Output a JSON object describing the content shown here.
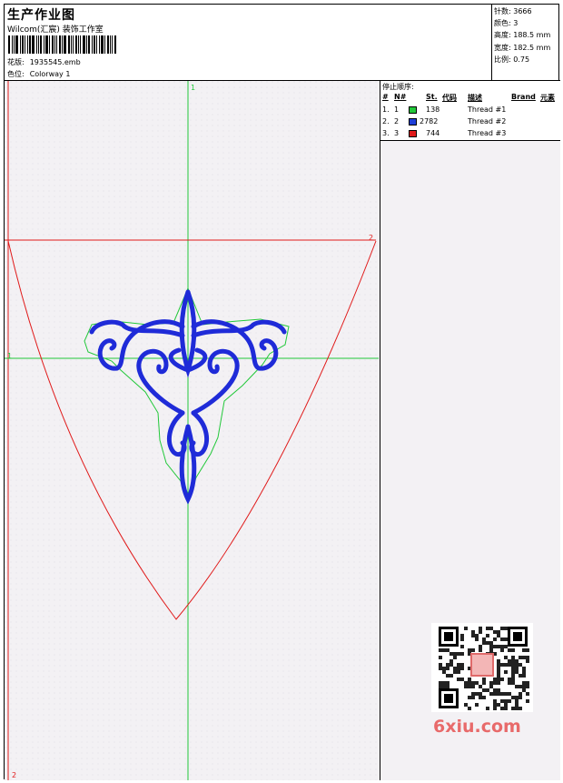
{
  "header": {
    "title": "生产作业图",
    "studio": "Wilcom(汇宸) 装饰工作室",
    "design_label": "花版:",
    "design_value": "1935545.emb",
    "colorway_label": "色位:",
    "colorway_value": "Colorway 1"
  },
  "specs": {
    "stitches": "针数: 3666",
    "colors": "颜色: 3",
    "height": "高度: 188.5 mm",
    "width": "宽度: 182.5 mm",
    "scale": "比例: 0.75"
  },
  "stop_sequence": {
    "title": "停止顺序:",
    "columns": {
      "hash": "#",
      "n": "N#",
      "st": "St.",
      "code": "代码",
      "desc": "描述",
      "brand": "Brand",
      "element": "元素"
    },
    "rows": [
      {
        "num": "1.",
        "n": "1",
        "color": "#22c83a",
        "st": "138",
        "desc": "Thread #1"
      },
      {
        "num": "2.",
        "n": "2",
        "color": "#1f3fd8",
        "st": "2782",
        "desc": "Thread #2"
      },
      {
        "num": "3.",
        "n": "3",
        "color": "#e01a1a",
        "st": "744",
        "desc": "Thread #3"
      }
    ]
  },
  "guides": {
    "top_marker": "1",
    "left_marker": "1",
    "right_marker": "2",
    "bottom_marker": "2"
  },
  "watermark": "6xiu.com",
  "colors": {
    "guide_green": "#22c83a",
    "guide_red": "#e01a1a",
    "embroidery_blue": "#1f2bd8"
  }
}
